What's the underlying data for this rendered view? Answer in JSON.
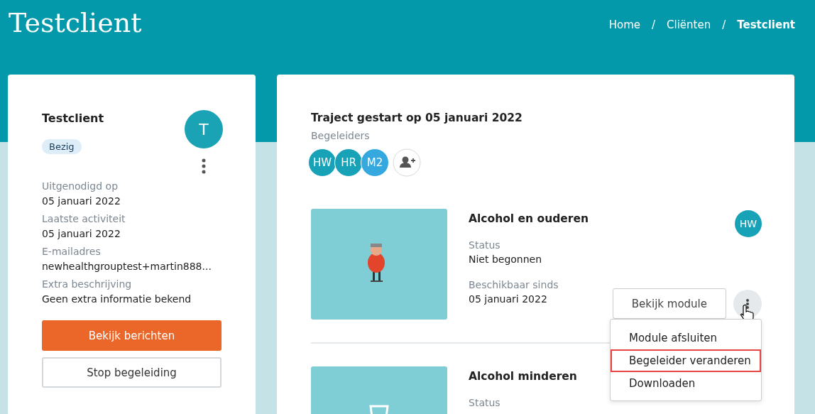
{
  "header": {
    "title": "Testclient",
    "separator": "/",
    "breadcrumbs": [
      {
        "label": "Home",
        "current": false
      },
      {
        "label": "Cliënten",
        "current": false
      },
      {
        "label": "Testclient",
        "current": true
      }
    ]
  },
  "client_card": {
    "name": "Testclient",
    "status": "Bezig",
    "avatar": "T",
    "fields": [
      {
        "label": "Uitgenodigd op",
        "value": "05 januari 2022"
      },
      {
        "label": "Laatste activiteit",
        "value": "05 januari 2022"
      },
      {
        "label": "E-mailadres",
        "value": "newhealthgrouptest+martin888..."
      },
      {
        "label": "Extra beschrijving",
        "value": "Geen extra informatie bekend"
      }
    ],
    "buttons": [
      {
        "label": "Bekijk berichten",
        "kind": "primary"
      },
      {
        "label": "Stop begeleiding",
        "kind": "outline"
      }
    ]
  },
  "trajectory": {
    "title": "Traject gestart op 05 januari 2022",
    "coaches_label": "Begeleiders",
    "coaches": [
      {
        "initials": "HW",
        "color": "#17a2b8"
      },
      {
        "initials": "HR",
        "color": "#17a2b8"
      },
      {
        "initials": "M2",
        "color": "#35a8e0"
      }
    ],
    "modules": [
      {
        "title": "Alcohol en ouderen",
        "status_label": "Status",
        "status": "Niet begonnen",
        "available_label": "Beschikbaar sinds",
        "available": "05 januari 2022",
        "coach": "HW",
        "button": "Bekijk module",
        "menu_open": true,
        "menu": [
          {
            "label": "Module afsluiten",
            "selected": false
          },
          {
            "label": "Begeleider veranderen",
            "selected": true
          },
          {
            "label": "Downloaden",
            "selected": false
          }
        ]
      },
      {
        "title": "Alcohol minderen",
        "status_label": "Status"
      }
    ]
  }
}
